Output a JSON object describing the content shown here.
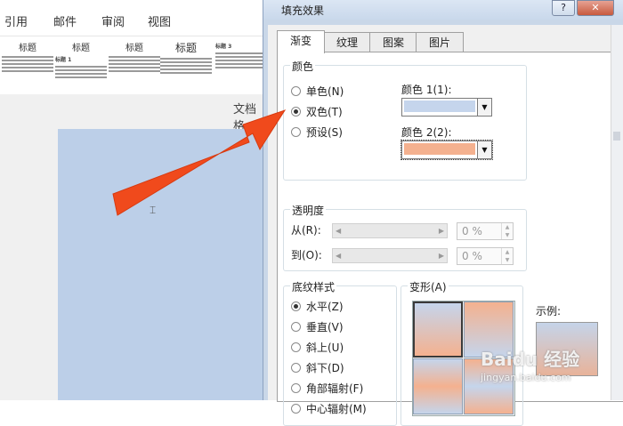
{
  "ribbon": {
    "tabs": [
      "引用",
      "邮件",
      "审阅",
      "视图"
    ]
  },
  "gallery": {
    "styles": [
      {
        "heading": "标题",
        "sub": ""
      },
      {
        "heading": "标题",
        "sub": "标题 1"
      },
      {
        "heading": "标题",
        "sub": ""
      },
      {
        "heading": "标题",
        "sub": ""
      },
      {
        "heading": "",
        "sub": "标题 3"
      }
    ]
  },
  "document": {
    "caption": "文档格"
  },
  "dialog": {
    "title": "填充效果",
    "help": "?",
    "close": "✕",
    "tabs": [
      "渐变",
      "纹理",
      "图案",
      "图片"
    ],
    "active_tab": "渐变",
    "colors_group": {
      "label": "颜色",
      "options": [
        "单色(N)",
        "双色(T)",
        "预设(S)"
      ],
      "selected": "双色(T)",
      "color1_label": "颜色 1(1):",
      "color1_value": "#c5d5ec",
      "color2_label": "颜色 2(2):",
      "color2_value": "#f4b18f"
    },
    "transparency": {
      "label": "透明度",
      "from_label": "从(R):",
      "to_label": "到(O):",
      "from_value": "0 %",
      "to_value": "0 %"
    },
    "shading": {
      "label": "底纹样式",
      "options": [
        "水平(Z)",
        "垂直(V)",
        "斜上(U)",
        "斜下(D)",
        "角部辐射(F)",
        "中心辐射(M)"
      ],
      "selected": "水平(Z)"
    },
    "variants": {
      "label": "变形(A)"
    },
    "sample": {
      "label": "示例:"
    }
  },
  "watermark": {
    "text": "Baidu 经验",
    "sub": "jingyan.baidu.com"
  },
  "colors": {
    "arrow": "#f04a1c",
    "page_fill": "#bccfe8"
  }
}
